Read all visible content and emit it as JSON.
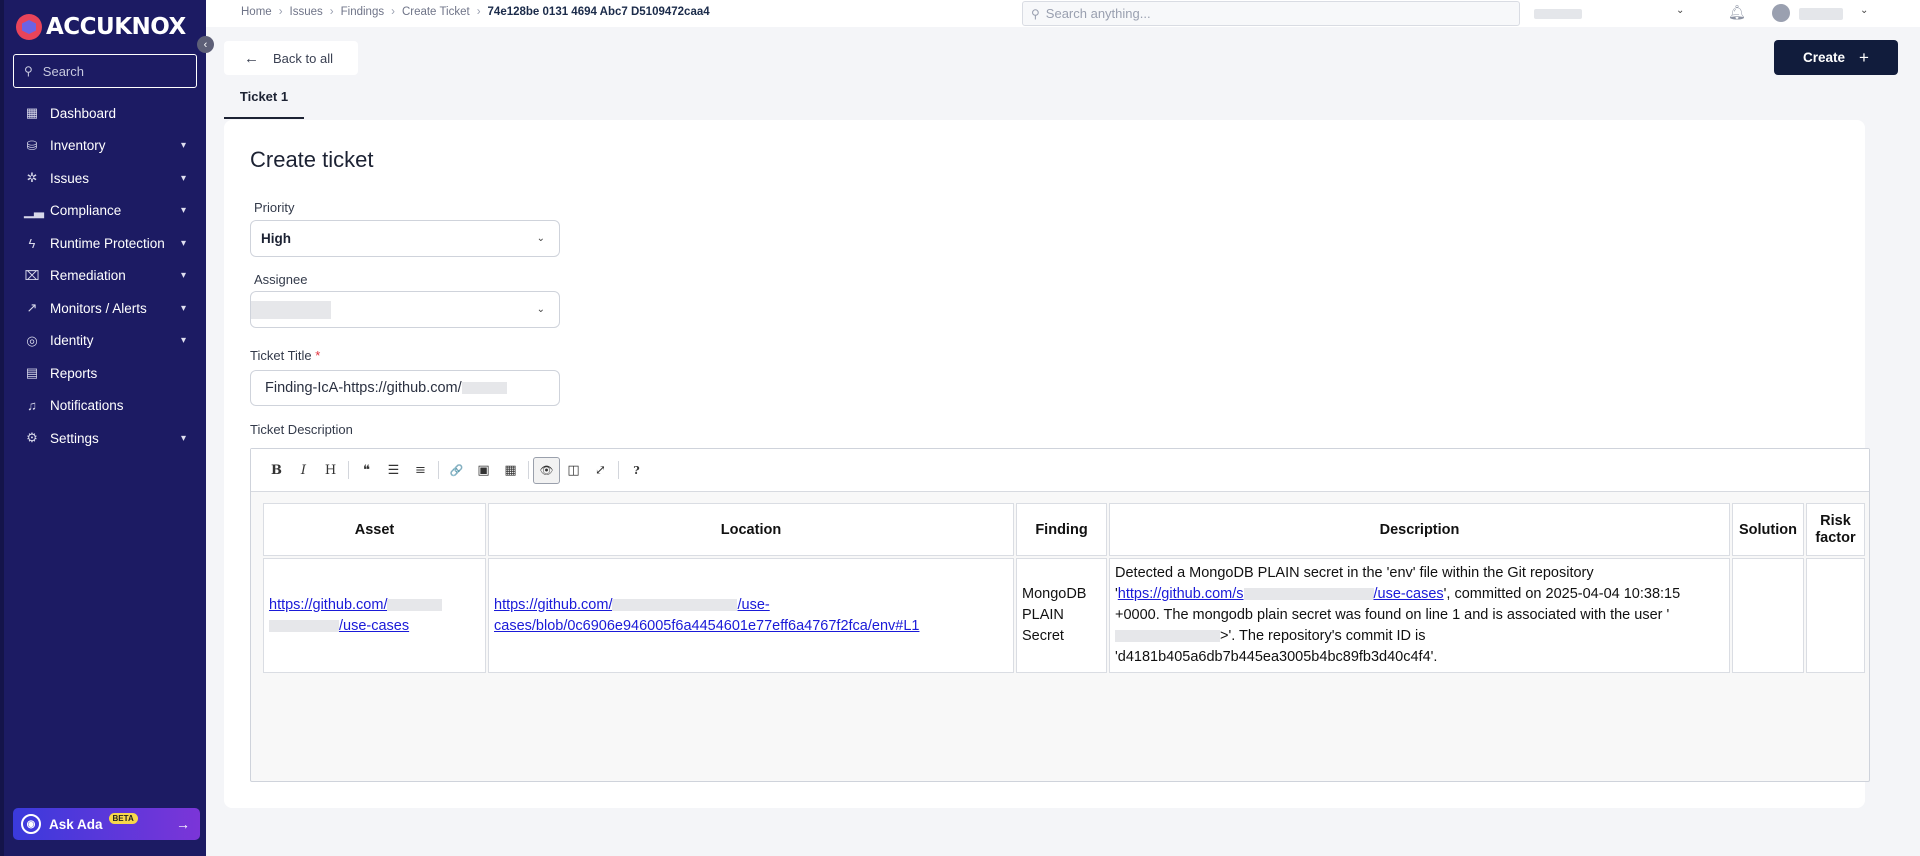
{
  "brand": {
    "name": "AccuKnox"
  },
  "sidebar": {
    "search_placeholder": "Search",
    "items": [
      {
        "label": "Dashboard",
        "icon": "dashboard-icon",
        "has_submenu": false
      },
      {
        "label": "Inventory",
        "icon": "inventory-icon",
        "has_submenu": true
      },
      {
        "label": "Issues",
        "icon": "bug-icon",
        "has_submenu": true
      },
      {
        "label": "Compliance",
        "icon": "compliance-icon",
        "has_submenu": true
      },
      {
        "label": "Runtime Protection",
        "icon": "runtime-icon",
        "has_submenu": true
      },
      {
        "label": "Remediation",
        "icon": "remediation-icon",
        "has_submenu": true
      },
      {
        "label": "Monitors / Alerts",
        "icon": "chart-line-icon",
        "has_submenu": true
      },
      {
        "label": "Identity",
        "icon": "fingerprint-icon",
        "has_submenu": true
      },
      {
        "label": "Reports",
        "icon": "report-icon",
        "has_submenu": false
      },
      {
        "label": "Notifications",
        "icon": "bell-icon",
        "has_submenu": false
      },
      {
        "label": "Settings",
        "icon": "gear-icon",
        "has_submenu": true
      }
    ],
    "ask_ada": {
      "label": "Ask Ada",
      "badge": "BETA"
    }
  },
  "topbar": {
    "breadcrumbs": [
      "Home",
      "Issues",
      "Findings",
      "Create Ticket",
      "74e128be 0131 4694 Abc7 D5109472caa4"
    ],
    "search_placeholder": "Search anything..."
  },
  "actions": {
    "back_label": "Back to all",
    "create_label": "Create"
  },
  "tabs": [
    {
      "label": "Ticket 1",
      "active": true
    }
  ],
  "form": {
    "title": "Create ticket",
    "priority": {
      "label": "Priority",
      "value": "High"
    },
    "assignee": {
      "label": "Assignee",
      "value": ""
    },
    "ticket_title": {
      "label": "Ticket Title",
      "required_mark": "*",
      "value": "Finding-IcA-https://github.com/"
    },
    "description_label": "Ticket Description"
  },
  "editor": {
    "toolbar": [
      {
        "name": "bold-icon",
        "glyph": "B"
      },
      {
        "name": "italic-icon",
        "glyph": "I"
      },
      {
        "name": "heading-icon",
        "glyph": "H"
      },
      {
        "name": "quote-icon",
        "glyph": "❝"
      },
      {
        "name": "unordered-list-icon",
        "glyph": "☰"
      },
      {
        "name": "ordered-list-icon",
        "glyph": "≡"
      },
      {
        "name": "link-icon",
        "glyph": "🔗"
      },
      {
        "name": "image-icon",
        "glyph": "▣"
      },
      {
        "name": "table-icon",
        "glyph": "▦"
      },
      {
        "name": "preview-icon",
        "glyph": "👁"
      },
      {
        "name": "side-by-side-icon",
        "glyph": "◫"
      },
      {
        "name": "fullscreen-icon",
        "glyph": "⤢"
      },
      {
        "name": "help-icon",
        "glyph": "?"
      }
    ],
    "table": {
      "headers": [
        "Asset",
        "Location",
        "Finding",
        "Description",
        "Solution",
        "Risk factor"
      ],
      "row": {
        "asset_link_a": "https://github.com/",
        "asset_link_b": "/use-cases",
        "location_link_a": "https://github.com/",
        "location_link_b": "/use-",
        "location_link_c": "cases/blob/0c6906e946005f6a4454601e77eff6a4767f2fca/env#L1",
        "finding": "MongoDB PLAIN Secret",
        "desc_1": "Detected a MongoDB PLAIN secret in the 'env' file within the Git repository '",
        "desc_link_a": "https://github.com/s",
        "desc_link_b": "/use-cases",
        "desc_2": "', committed on 2025-04-04 10:38:15 +0000. The mongodb plain secret was found on line 1 and is associated with the user '",
        "desc_3": ">'. The repository's commit ID is 'd4181b405a6db7b445ea3005b4bc89fb3d40c4f4'.",
        "solution": "",
        "risk_factor": ""
      }
    }
  }
}
